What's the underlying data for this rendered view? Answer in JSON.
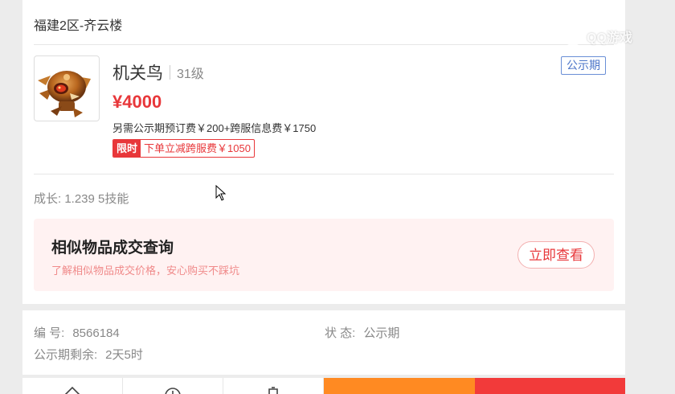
{
  "header": {
    "server": "福建2区-齐云楼"
  },
  "item": {
    "name": "机关鸟",
    "level": "31级",
    "status_tag": "公示期",
    "price": "¥4000",
    "fee_note": "另需公示期预订费￥200+跨服信息费￥1750",
    "promo_label": "限时",
    "promo_text": "下单立减跨服费￥1050",
    "growth": "成长: 1.239 5技能"
  },
  "similar": {
    "title": "相似物品成交查询",
    "subtitle": "了解相似物品成交价格，安心购买不踩坑",
    "button_label": "立即查看"
  },
  "info": {
    "id_label": "编 号:",
    "id_value": "8566184",
    "status_label": "状 态:",
    "status_value": "公示期",
    "remaining_label": "公示期剩余:",
    "remaining_value": "2天5时"
  },
  "watermark": {
    "text": "QQ游戏"
  },
  "colors": {
    "accent_red": "#e8373a",
    "status_blue": "#4a74c8",
    "bottom_orange": "#ff8a22",
    "bottom_red": "#f23a3a"
  }
}
